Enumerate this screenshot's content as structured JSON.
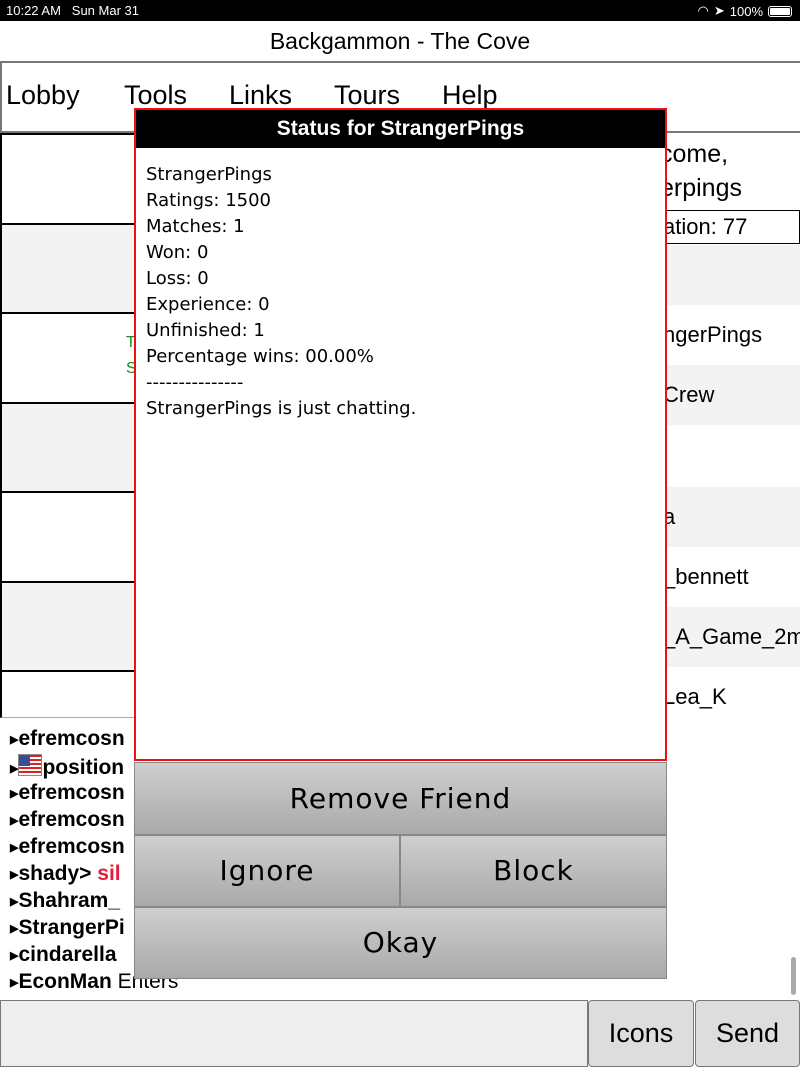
{
  "status_bar": {
    "time": "10:22 AM",
    "date": "Sun Mar 31",
    "battery": "100%"
  },
  "app": {
    "title": "Backgammon - The Cove"
  },
  "menu": [
    "Lobby",
    "Tools",
    "Links",
    "Tours",
    "Help"
  ],
  "left_panel": {
    "green_lines": [
      "T",
      "S"
    ]
  },
  "right_panel": {
    "welcome_line1": "come,",
    "welcome_line2": "erpings",
    "reputation": "ation: 77",
    "rows": [
      "",
      "ngerPings",
      "Crew",
      "",
      "a",
      "_bennett",
      "_A_Game_2m",
      "Lea_K"
    ]
  },
  "chat": [
    {
      "name": "efremcosn",
      "text": ""
    },
    {
      "name": "position",
      "text": "",
      "flag": "us-flag"
    },
    {
      "name": "efremcosn",
      "text": ""
    },
    {
      "name": "efremcosn",
      "text": ""
    },
    {
      "name": "efremcosn",
      "text": ""
    },
    {
      "name": "shady>",
      "text": "sil",
      "color": "#e0203a"
    },
    {
      "name": "Shahram_",
      "text": ""
    },
    {
      "name": "StrangerPi",
      "text": ""
    },
    {
      "name": "cindarella",
      "text": ""
    },
    {
      "name": "EconMan",
      "text": "Enters"
    }
  ],
  "dialog": {
    "title": "Status for StrangerPings",
    "lines": [
      "StrangerPings",
      "Ratings: 1500",
      "Matches: 1",
      "Won: 0",
      "Loss: 0",
      "Experience: 0",
      "Unfinished: 1",
      "Percentage wins: 00.00%",
      "---------------",
      "StrangerPings is just chatting."
    ],
    "remove_friend": "Remove Friend",
    "ignore": "Ignore",
    "block": "Block",
    "okay": "Okay"
  },
  "bottom": {
    "icons": "Icons",
    "send": "Send",
    "input_value": ""
  },
  "colors": {
    "dialog_border": "#ee1111",
    "green_text": "#1a8a1a",
    "chat_highlight": "#e0203a"
  }
}
